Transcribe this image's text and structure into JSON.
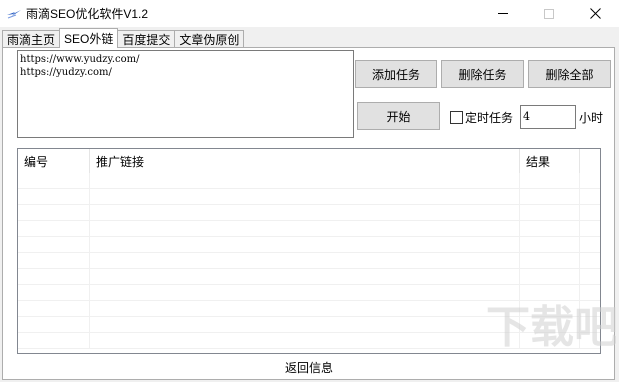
{
  "window": {
    "title": "雨滴SEO优化软件V1.2",
    "icon": "lightning-app-icon"
  },
  "tabs": [
    {
      "label": "雨滴主页",
      "active": false
    },
    {
      "label": "SEO外链",
      "active": true
    },
    {
      "label": "百度提交",
      "active": false
    },
    {
      "label": "文章伪原创",
      "active": false
    }
  ],
  "url_input": {
    "lines": [
      "https://www.yudzy.com/",
      "https://yudzy.com/"
    ]
  },
  "buttons": {
    "add_task": "添加任务",
    "delete_task": "删除任务",
    "delete_all": "删除全部",
    "start": "开始"
  },
  "timer": {
    "checkbox_label": "定时任务",
    "checked": false,
    "value": "4",
    "unit": "小时"
  },
  "table": {
    "columns": [
      "编号",
      "推广链接",
      "结果"
    ],
    "rows": []
  },
  "status_label": "返回信息",
  "colors": {
    "client_bg": "#f0f0f0",
    "button_bg": "#e1e1e1",
    "border": "#adadad"
  }
}
